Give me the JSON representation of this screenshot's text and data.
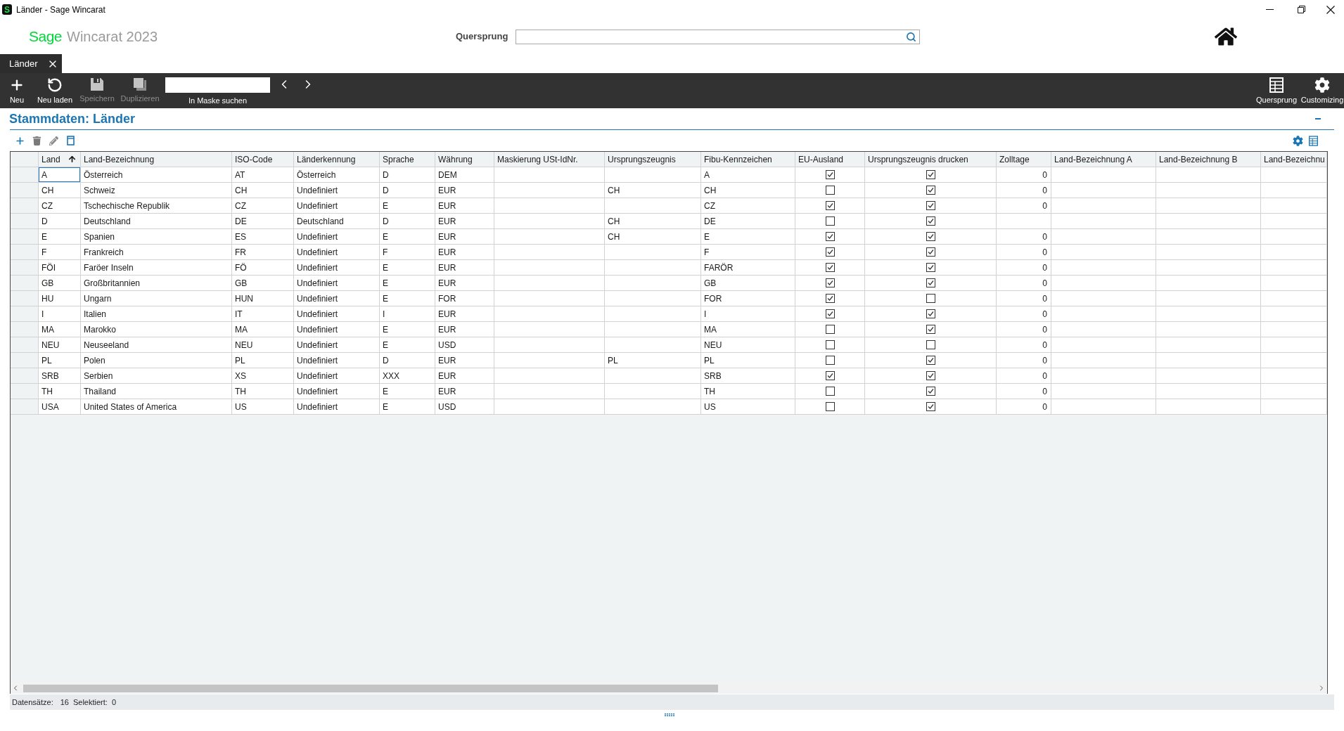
{
  "window": {
    "icon_letter": "S",
    "title": "Länder - Sage Wincarat"
  },
  "header": {
    "brand": "Sage",
    "product": "Wincarat 2023",
    "search": {
      "label": "Quersprung"
    }
  },
  "tabs": [
    {
      "label": "Länder",
      "selected": true
    }
  ],
  "toolbar": {
    "buttons": [
      {
        "label": "Neu",
        "disabled": false
      },
      {
        "label": "Neu laden",
        "disabled": false
      },
      {
        "label": "Speichern",
        "disabled": true
      },
      {
        "label": "Duplizieren",
        "disabled": true
      }
    ],
    "mask_search": {
      "label": "In Maske suchen"
    },
    "right_buttons": [
      {
        "label": "Quersprung"
      },
      {
        "label": "Customizing"
      }
    ]
  },
  "section": {
    "title": "Stammdaten: Länder"
  },
  "table": {
    "columns": [
      {
        "label": "Land",
        "kind": "text",
        "sorted": true
      },
      {
        "label": "Land-Bezeichnung",
        "kind": "text",
        "sorted": false
      },
      {
        "label": "ISO-Code",
        "kind": "text",
        "sorted": false
      },
      {
        "label": "Länderkennung",
        "kind": "text",
        "sorted": false
      },
      {
        "label": "Sprache",
        "kind": "text",
        "sorted": false
      },
      {
        "label": "Währung",
        "kind": "text",
        "sorted": false
      },
      {
        "label": "Maskierung USt-IdNr.",
        "kind": "text",
        "sorted": false
      },
      {
        "label": "Ursprungszeugnis",
        "kind": "text",
        "sorted": false
      },
      {
        "label": "Fibu-Kennzeichen",
        "kind": "text",
        "sorted": false
      },
      {
        "label": "EU-Ausland",
        "kind": "check",
        "sorted": false
      },
      {
        "label": "Ursprungszeugnis drucken",
        "kind": "check",
        "sorted": false
      },
      {
        "label": "Zolltage",
        "kind": "number",
        "sorted": false
      },
      {
        "label": "Land-Bezeichnung A",
        "kind": "text",
        "sorted": false
      },
      {
        "label": "Land-Bezeichnung B",
        "kind": "text",
        "sorted": false
      },
      {
        "label": "Land-Bezeichnu",
        "kind": "text",
        "sorted": false
      }
    ],
    "rows": [
      {
        "land": "A",
        "bezeichnung": "Österreich",
        "iso_code": "AT",
        "laenderkennung": "Österreich",
        "sprache": "D",
        "waehrung": "DEM",
        "fibu_kennzeichen": "A",
        "eu_ausland": true,
        "ursprungszeugnis_drucken": true,
        "zolltage": "0",
        "focused": true
      },
      {
        "land": "CH",
        "bezeichnung": "Schweiz",
        "iso_code": "CH",
        "laenderkennung": "Undefiniert",
        "sprache": "D",
        "waehrung": "EUR",
        "ursprungszeugnis": "CH",
        "fibu_kennzeichen": "CH",
        "eu_ausland": false,
        "ursprungszeugnis_drucken": true,
        "zolltage": "0",
        "focused": false
      },
      {
        "land": "CZ",
        "bezeichnung": "Tschechische Republik",
        "iso_code": "CZ",
        "laenderkennung": "Undefiniert",
        "sprache": "E",
        "waehrung": "EUR",
        "fibu_kennzeichen": "CZ",
        "eu_ausland": true,
        "ursprungszeugnis_drucken": true,
        "zolltage": "0",
        "focused": false
      },
      {
        "land": "D",
        "bezeichnung": "Deutschland",
        "iso_code": "DE",
        "laenderkennung": "Deutschland",
        "sprache": "D",
        "waehrung": "EUR",
        "ursprungszeugnis": "CH",
        "fibu_kennzeichen": "DE",
        "eu_ausland": false,
        "ursprungszeugnis_drucken": true,
        "focused": false
      },
      {
        "land": "E",
        "bezeichnung": "Spanien",
        "iso_code": "ES",
        "laenderkennung": "Undefiniert",
        "sprache": "E",
        "waehrung": "EUR",
        "ursprungszeugnis": "CH",
        "fibu_kennzeichen": "E",
        "eu_ausland": true,
        "ursprungszeugnis_drucken": true,
        "zolltage": "0",
        "focused": false
      },
      {
        "land": "F",
        "bezeichnung": "Frankreich",
        "iso_code": "FR",
        "laenderkennung": "Undefiniert",
        "sprache": "F",
        "waehrung": "EUR",
        "fibu_kennzeichen": "F",
        "eu_ausland": true,
        "ursprungszeugnis_drucken": true,
        "zolltage": "0",
        "focused": false
      },
      {
        "land": "FÖI",
        "bezeichnung": "Faröer Inseln",
        "iso_code": "FÖ",
        "laenderkennung": "Undefiniert",
        "sprache": "E",
        "waehrung": "EUR",
        "fibu_kennzeichen": "FARÖR",
        "eu_ausland": true,
        "ursprungszeugnis_drucken": true,
        "zolltage": "0",
        "focused": false
      },
      {
        "land": "GB",
        "bezeichnung": "Großbritannien",
        "iso_code": "GB",
        "laenderkennung": "Undefiniert",
        "sprache": "E",
        "waehrung": "EUR",
        "fibu_kennzeichen": "GB",
        "eu_ausland": true,
        "ursprungszeugnis_drucken": true,
        "zolltage": "0",
        "focused": false
      },
      {
        "land": "HU",
        "bezeichnung": "Ungarn",
        "iso_code": "HUN",
        "laenderkennung": "Undefiniert",
        "sprache": "E",
        "waehrung": "FOR",
        "fibu_kennzeichen": "FOR",
        "eu_ausland": true,
        "ursprungszeugnis_drucken": false,
        "zolltage": "0",
        "focused": false
      },
      {
        "land": "I",
        "bezeichnung": "Italien",
        "iso_code": "IT",
        "laenderkennung": "Undefiniert",
        "sprache": "I",
        "waehrung": "EUR",
        "fibu_kennzeichen": "I",
        "eu_ausland": true,
        "ursprungszeugnis_drucken": true,
        "zolltage": "0",
        "focused": false
      },
      {
        "land": "MA",
        "bezeichnung": "Marokko",
        "iso_code": "MA",
        "laenderkennung": "Undefiniert",
        "sprache": "E",
        "waehrung": "EUR",
        "fibu_kennzeichen": "MA",
        "eu_ausland": false,
        "ursprungszeugnis_drucken": true,
        "zolltage": "0",
        "focused": false
      },
      {
        "land": "NEU",
        "bezeichnung": "Neuseeland",
        "iso_code": "NEU",
        "laenderkennung": "Undefiniert",
        "sprache": "E",
        "waehrung": "USD",
        "fibu_kennzeichen": "NEU",
        "eu_ausland": false,
        "ursprungszeugnis_drucken": false,
        "zolltage": "0",
        "focused": false
      },
      {
        "land": "PL",
        "bezeichnung": "Polen",
        "iso_code": "PL",
        "laenderkennung": "Undefiniert",
        "sprache": "D",
        "waehrung": "EUR",
        "ursprungszeugnis": "PL",
        "fibu_kennzeichen": "PL",
        "eu_ausland": false,
        "ursprungszeugnis_drucken": true,
        "zolltage": "0",
        "focused": false
      },
      {
        "land": "SRB",
        "bezeichnung": "Serbien",
        "iso_code": "XS",
        "laenderkennung": "Undefiniert",
        "sprache": "XXX",
        "waehrung": "EUR",
        "fibu_kennzeichen": "SRB",
        "eu_ausland": true,
        "ursprungszeugnis_drucken": true,
        "zolltage": "0",
        "focused": false
      },
      {
        "land": "TH",
        "bezeichnung": "Thailand",
        "iso_code": "TH",
        "laenderkennung": "Undefiniert",
        "sprache": "E",
        "waehrung": "EUR",
        "fibu_kennzeichen": "TH",
        "eu_ausland": false,
        "ursprungszeugnis_drucken": true,
        "zolltage": "0",
        "focused": false
      },
      {
        "land": "USA",
        "bezeichnung": "United States of America",
        "iso_code": "US",
        "laenderkennung": "Undefiniert",
        "sprache": "E",
        "waehrung": "USD",
        "fibu_kennzeichen": "US",
        "eu_ausland": false,
        "ursprungszeugnis_drucken": true,
        "zolltage": "0",
        "focused": false
      }
    ]
  },
  "status_bar": {
    "records_label": "Datensätze:",
    "records": "16",
    "selected_label": "Selektiert:",
    "selected": "0"
  }
}
